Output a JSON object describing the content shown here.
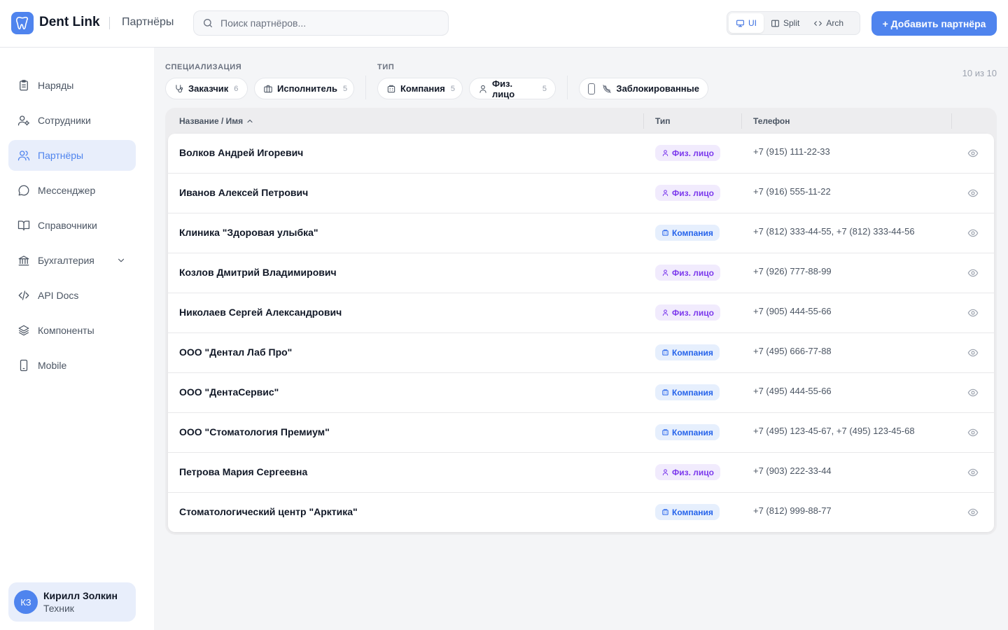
{
  "header": {
    "app_name": "Dent Link",
    "page_title": "Партнёры",
    "search_placeholder": "Поиск партнёров...",
    "view_modes": [
      {
        "label": "UI",
        "icon": "monitor-icon",
        "active": true
      },
      {
        "label": "Split",
        "icon": "split-columns-icon",
        "active": false
      },
      {
        "label": "Arch",
        "icon": "code-icon",
        "active": false
      }
    ],
    "add_button": "+ Добавить партнёра"
  },
  "sidebar": {
    "items": [
      {
        "label": "Наряды",
        "icon": "clipboard-icon"
      },
      {
        "label": "Сотрудники",
        "icon": "user-gear-icon"
      },
      {
        "label": "Партнёры",
        "icon": "users-icon",
        "active": true
      },
      {
        "label": "Мессенджер",
        "icon": "chat-bubble-icon"
      },
      {
        "label": "Справочники",
        "icon": "book-open-icon"
      },
      {
        "label": "Бухгалтерия",
        "icon": "bank-icon",
        "has_submenu": true
      },
      {
        "label": "API Docs",
        "icon": "code-icon"
      },
      {
        "label": "Компоненты",
        "icon": "layers-icon"
      },
      {
        "label": "Mobile",
        "icon": "smartphone-icon"
      }
    ],
    "user": {
      "initials": "КЗ",
      "name": "Кирилл Золкин",
      "role": "Техник"
    }
  },
  "filters": {
    "specialization_label": "СПЕЦИАЛИЗАЦИЯ",
    "type_label": "ТИП",
    "specialization": [
      {
        "label": "Заказчик",
        "count": "6",
        "icon": "stethoscope-icon"
      },
      {
        "label": "Исполнитель",
        "count": "5",
        "icon": "briefcase-icon"
      }
    ],
    "type": [
      {
        "label": "Компания",
        "count": "5",
        "icon": "building-icon"
      },
      {
        "label": "Физ. лицо",
        "count": "5",
        "icon": "person-icon"
      }
    ],
    "blocked": {
      "label": "Заблокированные",
      "checked": false,
      "icon": "phone-off-icon"
    },
    "counter": "10 из 10"
  },
  "table": {
    "columns": {
      "name": "Название / Имя",
      "type": "Тип",
      "phone": "Телефон"
    },
    "sort": {
      "column": "name",
      "direction": "asc"
    },
    "type_labels": {
      "person": "Физ. лицо",
      "company": "Компания"
    },
    "colors": {
      "person_bg": "#f1ebfd",
      "person_fg": "#7c3aed",
      "company_bg": "#e6effd",
      "company_fg": "#2563eb"
    },
    "rows": [
      {
        "name": "Волков Андрей Игоревич",
        "type": "person",
        "type_label": "Физ. лицо",
        "phone": "+7 (915) 111-22-33"
      },
      {
        "name": "Иванов Алексей Петрович",
        "type": "person",
        "type_label": "Физ. лицо",
        "phone": "+7 (916) 555-11-22"
      },
      {
        "name": "Клиника \"Здоровая улыбка\"",
        "type": "company",
        "type_label": "Компания",
        "phone": "+7 (812) 333-44-55, +7 (812) 333-44-56"
      },
      {
        "name": "Козлов Дмитрий Владимирович",
        "type": "person",
        "type_label": "Физ. лицо",
        "phone": "+7 (926) 777-88-99"
      },
      {
        "name": "Николаев Сергей Александрович",
        "type": "person",
        "type_label": "Физ. лицо",
        "phone": "+7 (905) 444-55-66"
      },
      {
        "name": "ООО \"Дентал Лаб Про\"",
        "type": "company",
        "type_label": "Компания",
        "phone": "+7 (495) 666-77-88"
      },
      {
        "name": "ООО \"ДентаСервис\"",
        "type": "company",
        "type_label": "Компания",
        "phone": "+7 (495) 444-55-66"
      },
      {
        "name": "ООО \"Стоматология Премиум\"",
        "type": "company",
        "type_label": "Компания",
        "phone": "+7 (495) 123-45-67, +7 (495) 123-45-68"
      },
      {
        "name": "Петрова Мария Сергеевна",
        "type": "person",
        "type_label": "Физ. лицо",
        "phone": "+7 (903) 222-33-44"
      },
      {
        "name": "Стоматологический центр \"Арктика\"",
        "type": "company",
        "type_label": "Компания",
        "phone": "+7 (812) 999-88-77"
      }
    ]
  },
  "colors": {
    "accent": "#4f84ee",
    "active_bg": "#e8eefb"
  }
}
